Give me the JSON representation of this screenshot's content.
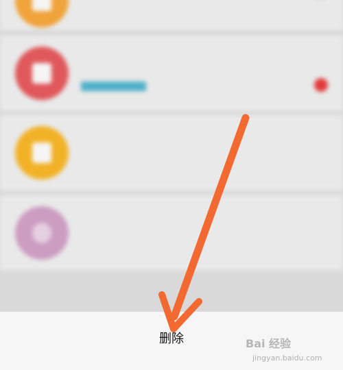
{
  "conversations": [
    {
      "title": "",
      "preview": "",
      "meta": "",
      "has_badge": true,
      "avatar_color": "#f0a33a"
    },
    {
      "title": "",
      "preview": "",
      "meta": "",
      "has_badge": true,
      "avatar_color": "#e0585b"
    },
    {
      "title": "",
      "preview": "",
      "meta": "",
      "has_badge": false,
      "avatar_color": "#f2b227"
    },
    {
      "title": "",
      "preview": "",
      "meta": "",
      "has_badge": false,
      "avatar_color": "#cc9cc1"
    }
  ],
  "action_sheet": {
    "delete_label": "删除"
  },
  "watermark": {
    "logo": "Bai 经验",
    "url": "jingyan.baidu.com"
  },
  "annotation": {
    "arrow_color": "#f26a32"
  }
}
